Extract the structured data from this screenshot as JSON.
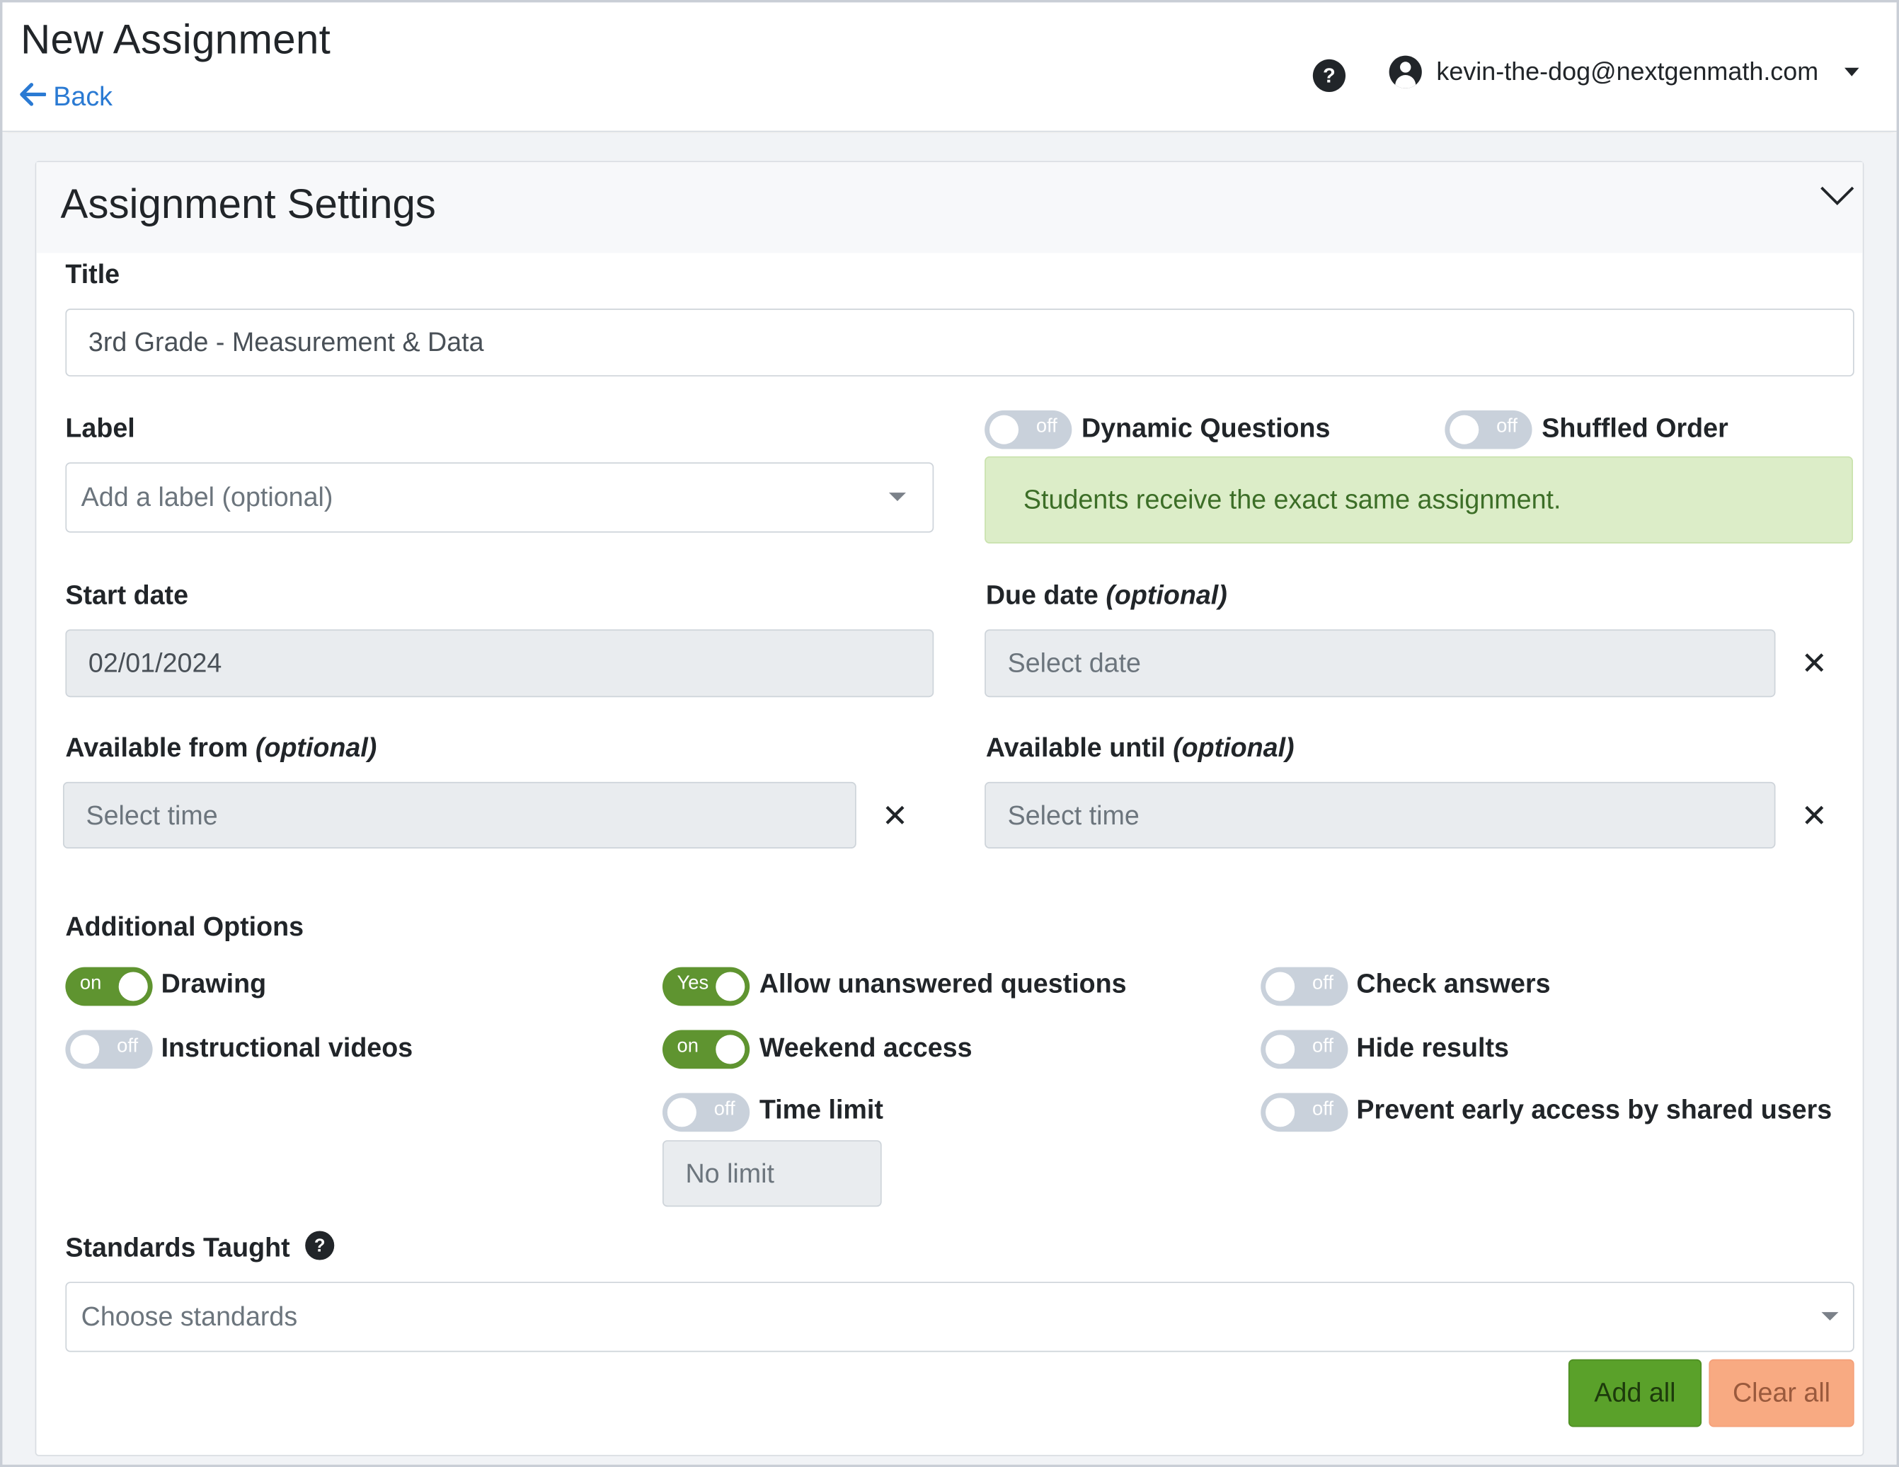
{
  "header": {
    "title": "New Assignment",
    "back_label": "Back",
    "help_icon": "question-circle-icon",
    "user_email": "kevin-the-dog@nextgenmath.com"
  },
  "settings": {
    "card_title": "Assignment Settings",
    "title_label": "Title",
    "title_value": "3rd Grade - Measurement & Data",
    "label_label": "Label",
    "label_placeholder": "Add a label (optional)",
    "dynamic_questions": {
      "label": "Dynamic Questions",
      "state": "off"
    },
    "shuffled_order": {
      "label": "Shuffled Order",
      "state": "off"
    },
    "info_message": "Students receive the exact same assignment.",
    "start_date_label": "Start date",
    "start_date_value": "02/01/2024",
    "due_date_label": "Due date",
    "due_date_optional": "(optional)",
    "due_date_placeholder": "Select date",
    "available_from_label": "Available from",
    "available_from_optional": "(optional)",
    "available_from_placeholder": "Select time",
    "available_until_label": "Available until",
    "available_until_optional": "(optional)",
    "available_until_placeholder": "Select time",
    "clear_symbol": "✕"
  },
  "options": {
    "heading": "Additional Options",
    "drawing": {
      "label": "Drawing",
      "state": "on"
    },
    "instructional_videos": {
      "label": "Instructional videos",
      "state": "off"
    },
    "allow_unanswered": {
      "label": "Allow unanswered questions",
      "state": "Yes"
    },
    "weekend_access": {
      "label": "Weekend access",
      "state": "on"
    },
    "time_limit": {
      "label": "Time limit",
      "state": "off",
      "value": "No limit"
    },
    "check_answers": {
      "label": "Check answers",
      "state": "off"
    },
    "hide_results": {
      "label": "Hide results",
      "state": "off"
    },
    "prevent_early_access": {
      "label": "Prevent early access by shared users",
      "state": "off"
    }
  },
  "standards": {
    "label": "Standards Taught",
    "placeholder": "Choose standards",
    "add_all": "Add all",
    "clear_all": "Clear all"
  },
  "colors": {
    "toggle_on": "#5f9430",
    "toggle_off": "#c9d1db",
    "link": "#2a7ad3",
    "alert_bg": "#dcedc8",
    "add_button": "#5aa12a",
    "clear_button": "#f8aa82"
  }
}
